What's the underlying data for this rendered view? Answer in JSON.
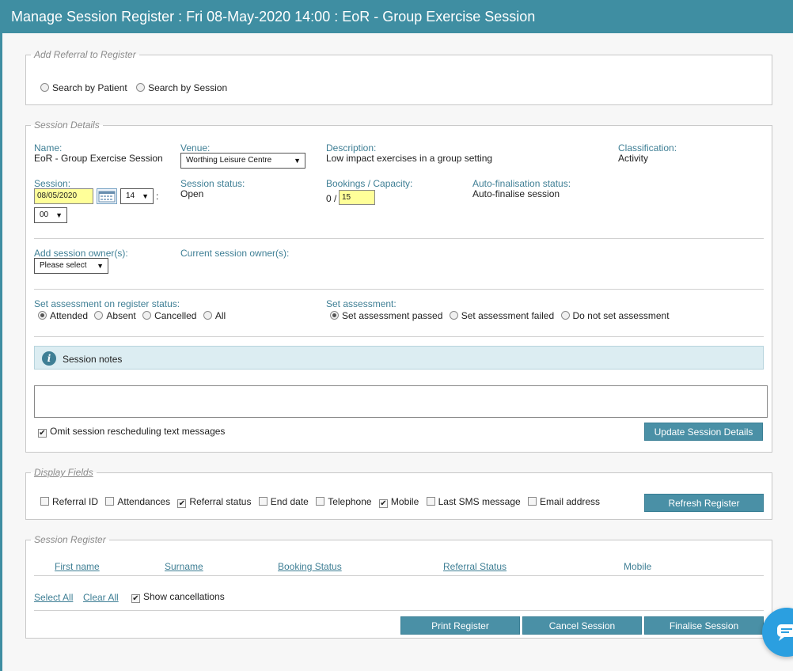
{
  "title": "Manage Session Register : Fri 08-May-2020 14:00 : EoR - Group Exercise Session",
  "add_referral": {
    "legend": "Add Referral to Register",
    "options": [
      {
        "label": "Search by Patient",
        "checked": false
      },
      {
        "label": "Search by Session",
        "checked": false
      }
    ]
  },
  "session_details": {
    "legend": "Session Details",
    "name_label": "Name:",
    "name_value": "EoR - Group Exercise Session",
    "venue_label": "Venue:",
    "venue_value": "Worthing Leisure Centre",
    "description_label": "Description:",
    "description_value": "Low impact exercises in a group setting",
    "classification_label": "Classification:",
    "classification_value": "Activity",
    "session_label": "Session:",
    "session_date": "08/05/2020",
    "session_hour": "14",
    "time_separator": ":",
    "session_minute": "00",
    "status_label": "Session status:",
    "status_value": "Open",
    "bookings_label": "Bookings / Capacity:",
    "bookings_value": "0 /",
    "capacity_value": "15",
    "autofinal_label": "Auto-finalisation status:",
    "autofinal_value": "Auto-finalise session",
    "add_owner_label": "Add session owner(s):",
    "add_owner_select": "Please select",
    "current_owner_label": "Current session owner(s):",
    "assess_status_label": "Set assessment on register status:",
    "assess_status_options": [
      {
        "label": "Attended",
        "checked": true
      },
      {
        "label": "Absent",
        "checked": false
      },
      {
        "label": "Cancelled",
        "checked": false
      },
      {
        "label": "All",
        "checked": false
      }
    ],
    "set_assess_label": "Set assessment:",
    "set_assess_options": [
      {
        "label": "Set assessment passed",
        "checked": true
      },
      {
        "label": "Set assessment failed",
        "checked": false
      },
      {
        "label": "Do not set assessment",
        "checked": false
      }
    ],
    "notes_label": "Session notes",
    "notes_value": "",
    "omit_sms_label": "Omit session rescheduling text messages",
    "omit_sms_checked": true,
    "update_button": "Update Session Details"
  },
  "display_fields": {
    "legend": "Display Fields",
    "fields": [
      {
        "label": "Referral ID",
        "checked": false
      },
      {
        "label": "Attendances",
        "checked": false
      },
      {
        "label": "Referral status",
        "checked": true
      },
      {
        "label": "End date",
        "checked": false
      },
      {
        "label": "Telephone",
        "checked": false
      },
      {
        "label": "Mobile",
        "checked": true
      },
      {
        "label": "Last SMS message",
        "checked": false
      },
      {
        "label": "Email address",
        "checked": false
      }
    ],
    "refresh_button": "Refresh Register"
  },
  "session_register": {
    "legend": "Session Register",
    "columns": [
      "First name",
      "Surname",
      "Booking Status",
      "Referral Status",
      "Mobile"
    ],
    "select_all": "Select All",
    "clear_all": "Clear All",
    "show_cancellations_label": "Show cancellations",
    "show_cancellations_checked": true,
    "print_button": "Print Register",
    "cancel_button": "Cancel Session",
    "finalise_button": "Finalise Session"
  },
  "icons": {
    "info": "info-icon",
    "calendar": "calendar-icon",
    "dropdown": "chevron-down-icon",
    "chat": "chat-icon"
  },
  "colors": {
    "header": "#3f8ea2",
    "label": "#3f7f95",
    "button": "#4a90a6",
    "highlight_input": "#ffff99",
    "notes_bar": "#dcedf2",
    "chat": "#2b9fe0"
  }
}
